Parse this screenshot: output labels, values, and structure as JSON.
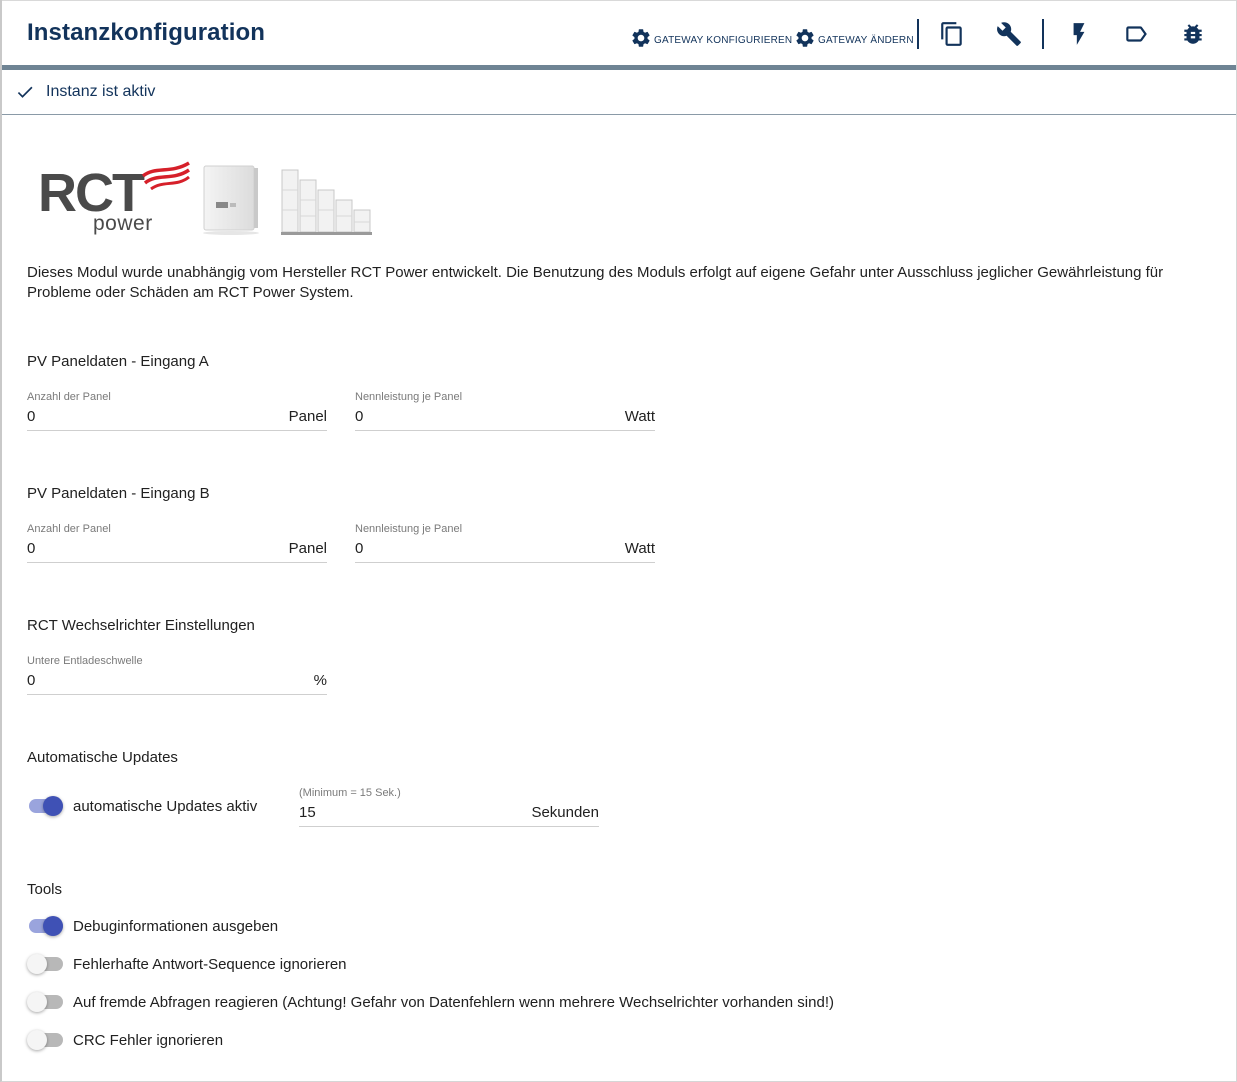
{
  "header": {
    "title": "Instanzkonfiguration",
    "btn_configure_gateway": "GATEWAY KONFIGURIEREN",
    "btn_change_gateway": "GATEWAY ÄNDERN",
    "icons": [
      "copy-icon",
      "wrench-icon",
      "flash-icon",
      "label-icon",
      "bug-icon"
    ]
  },
  "status": {
    "text": "Instanz ist aktiv"
  },
  "logo": {
    "brand": "RCT",
    "sub": "power"
  },
  "disclaimer": "Dieses Modul wurde unabhängig vom Hersteller RCT Power entwickelt. Die Benutzung des Moduls erfolgt auf eigene Gefahr unter Ausschluss jeglicher Gewährleistung für Probleme oder Schäden am RCT Power System.",
  "pv_a": {
    "title": "PV Paneldaten - Eingang A",
    "count": {
      "label": "Anzahl der Panel",
      "value": "0",
      "unit": "Panel"
    },
    "power": {
      "label": "Nennleistung je Panel",
      "value": "0",
      "unit": "Watt"
    }
  },
  "pv_b": {
    "title": "PV Paneldaten - Eingang B",
    "count": {
      "label": "Anzahl der Panel",
      "value": "0",
      "unit": "Panel"
    },
    "power": {
      "label": "Nennleistung je Panel",
      "value": "0",
      "unit": "Watt"
    }
  },
  "inverter": {
    "title": "RCT Wechselrichter Einstellungen",
    "threshold": {
      "label": "Untere Entladeschwelle",
      "value": "0",
      "unit": "%"
    }
  },
  "updates": {
    "title": "Automatische Updates",
    "toggle_label": "automatische Updates aktiv",
    "toggle_on": true,
    "interval": {
      "label": "(Minimum = 15 Sek.)",
      "value": "15",
      "unit": "Sekunden"
    }
  },
  "tools": {
    "title": "Tools",
    "items": [
      {
        "label": "Debuginformationen ausgeben",
        "on": true
      },
      {
        "label": "Fehlerhafte Antwort-Sequence ignorieren",
        "on": false
      },
      {
        "label": "Auf fremde Abfragen reagieren (Achtung! Gefahr von Datenfehlern wenn mehrere Wechselrichter vorhanden sind!)",
        "on": false
      },
      {
        "label": "CRC Fehler ignorieren",
        "on": false
      }
    ]
  },
  "colors": {
    "primary": "#12335b",
    "accent": "#3f51b5",
    "logo_red": "#d6202a"
  }
}
